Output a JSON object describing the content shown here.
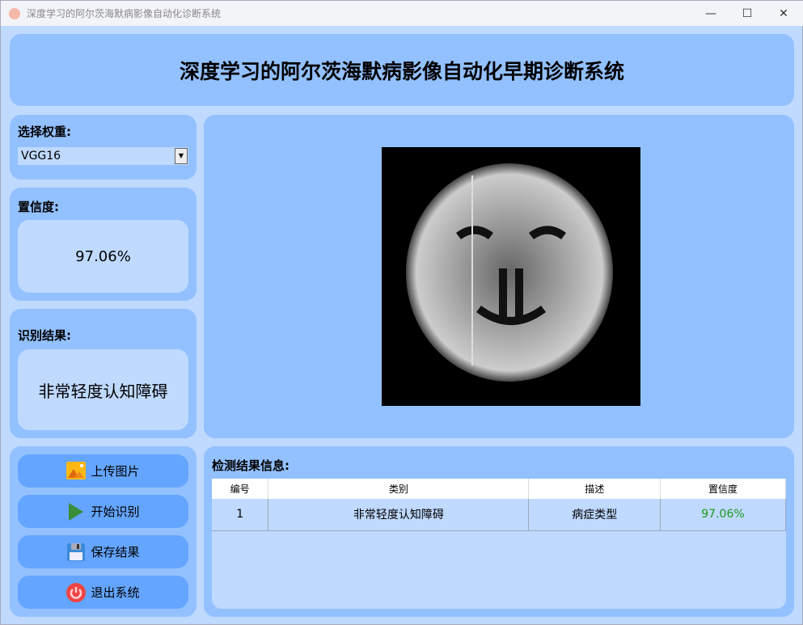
{
  "window": {
    "title": "深度学习的阿尔茨海默病影像自动化诊断系统",
    "minimize": "—",
    "maximize": "☐",
    "close": "✕"
  },
  "header": {
    "title": "深度学习的阿尔茨海默病影像自动化早期诊断系统"
  },
  "weights": {
    "label": "选择权重:",
    "selected": "VGG16"
  },
  "confidence": {
    "label": "置信度:",
    "value": "97.06%"
  },
  "result": {
    "label": "识别结果:",
    "value": "非常轻度认知障碍"
  },
  "buttons": {
    "upload": "上传图片",
    "start": "开始识别",
    "save": "保存结果",
    "exit": "退出系统"
  },
  "table": {
    "title": "检测结果信息:",
    "columns": [
      "编号",
      "类别",
      "描述",
      "置信度"
    ],
    "rows": [
      [
        "1",
        "非常轻度认知障碍",
        "病症类型",
        "97.06%"
      ]
    ]
  },
  "colors": {
    "bg": "#bfd9ff",
    "panel": "#93c1ff",
    "button": "#64a5ff",
    "confidence_text": "#1a9a1a"
  }
}
